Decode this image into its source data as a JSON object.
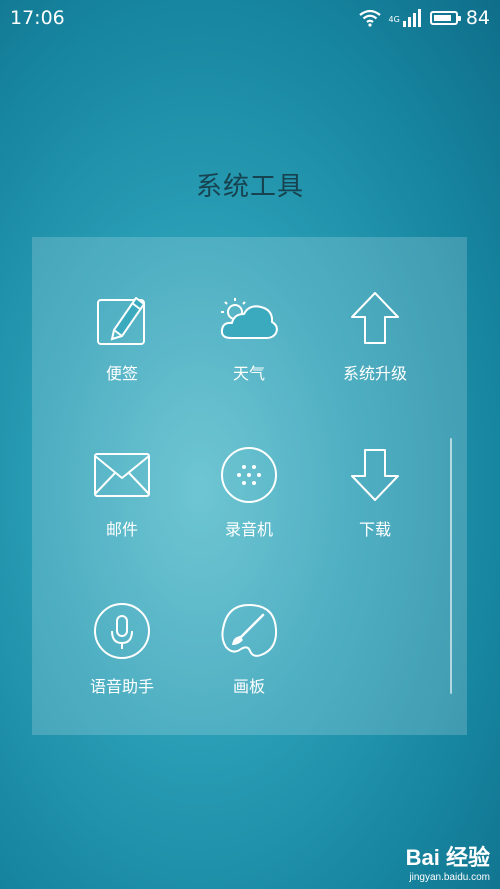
{
  "status_bar": {
    "time": "17:06",
    "network": "4G",
    "battery": "84",
    "battery_level": 0.84
  },
  "folder": {
    "title": "系统工具",
    "apps": [
      {
        "label": "便签",
        "icon": "notes-icon"
      },
      {
        "label": "天气",
        "icon": "weather-icon"
      },
      {
        "label": "系统升级",
        "icon": "system-update-icon"
      },
      {
        "label": "邮件",
        "icon": "mail-icon"
      },
      {
        "label": "录音机",
        "icon": "recorder-icon"
      },
      {
        "label": "下载",
        "icon": "download-icon"
      },
      {
        "label": "语音助手",
        "icon": "voice-assistant-icon"
      },
      {
        "label": "画板",
        "icon": "paint-palette-icon"
      }
    ]
  },
  "watermark": {
    "logo": "Bai 经验",
    "url": "jingyan.baidu.com"
  }
}
